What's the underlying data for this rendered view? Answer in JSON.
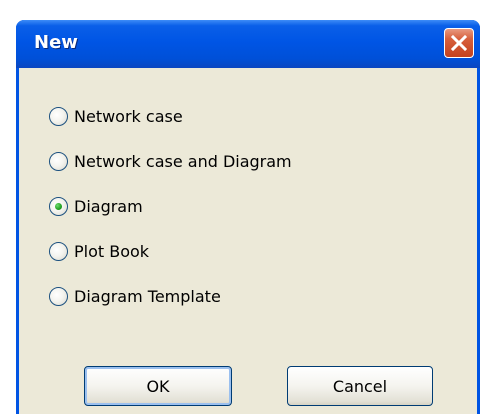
{
  "window": {
    "title": "New",
    "close_icon": "close-icon"
  },
  "options": [
    {
      "label": "Network case",
      "selected": false
    },
    {
      "label": "Network case and Diagram",
      "selected": false
    },
    {
      "label": "Diagram",
      "selected": true
    },
    {
      "label": "Plot Book",
      "selected": false
    },
    {
      "label": "Diagram Template",
      "selected": false
    }
  ],
  "buttons": {
    "ok_label": "OK",
    "cancel_label": "Cancel"
  },
  "colors": {
    "titlebar": "#0054e3",
    "client_bg": "#ece9d8",
    "close_button": "#c3411e",
    "radio_selected_dot": "#21a121"
  }
}
